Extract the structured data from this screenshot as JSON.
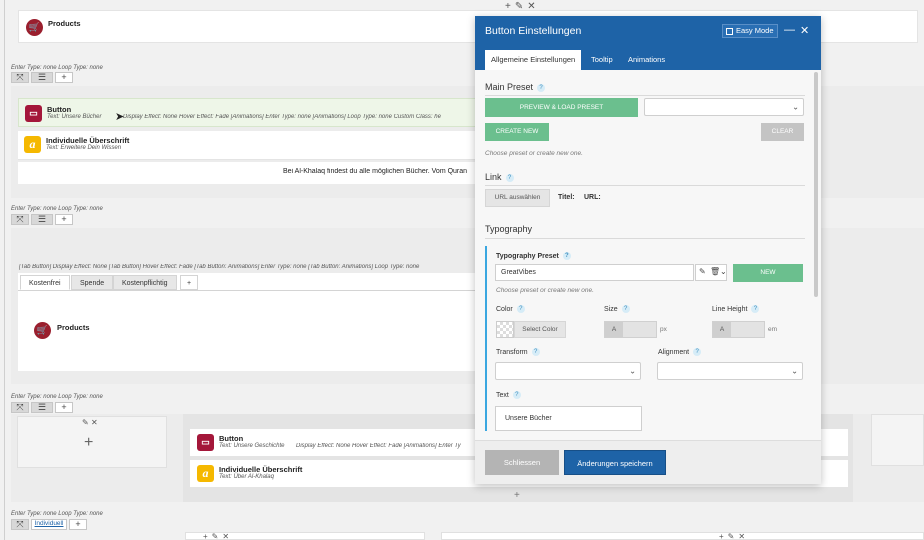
{
  "canvas": {
    "enter_type_label": "Enter Type: none  Loop Type: none",
    "products_label": "Products",
    "row_text": "Bei Al-Khalaq findest du alle möglichen Bücher. Vom Quran",
    "button_title": "Button",
    "button_sub": "Text: Unsere Bücher",
    "button_meta": "Display Effect: None      Hover Effect: Fade      [Animations] Enter Type: none      [Animations] Loop Type: none      Custom Class: he",
    "heading_title": "Individuelle Überschrift",
    "heading_sub": "Text: Erweitere Dein Wissen",
    "tab_meta": "[Tab Button] Display Effect: None    [Tab Button] Hover Effect: Fade    [Tab Button: Animations] Enter Type: none    [Tab Button: Animations] Loop Type: none",
    "tabs": [
      "Kostenfrei",
      "Spende",
      "Kostenpflichtig"
    ],
    "button2_title": "Button",
    "button2_sub": "Text: Unsere Geschichte",
    "button2_meta": "Display Effect: None      Hover Effect: Fade      [Animations] Enter Ty",
    "heading2_title": "Individuelle Überschrift",
    "heading2_sub": "Text: Über Al-Khalaq",
    "bottom_tab": "Individuell",
    "icons": {
      "move": "move-icon",
      "layout": "columns-icon",
      "add": "plus-icon",
      "edit": "pencil-icon",
      "close": "close-icon"
    }
  },
  "modal": {
    "title": "Button Einstellungen",
    "easy_mode": "Easy Mode",
    "tabs": [
      "Allgemeine Einstellungen",
      "Tooltip",
      "Animations"
    ],
    "main_preset": "Main Preset",
    "preview_btn": "PREVIEW & LOAD PRESET",
    "create_new": "CREATE NEW",
    "clear": "CLEAR",
    "preset_hint": "Choose preset or create new one.",
    "link": "Link",
    "url_btn": "URL auswählen",
    "titel": "Titel:",
    "url": "URL:",
    "typography": "Typography",
    "typo_preset": "Typography Preset",
    "typo_value": "GreatVibes",
    "new_btn": "NEW",
    "typo_hint": "Choose preset or create new one.",
    "color": "Color",
    "select_color": "Select Color",
    "size": "Size",
    "size_unit": "px",
    "line_height": "Line Height",
    "lh_unit": "em",
    "num_a": "A",
    "transform": "Transform",
    "alignment": "Alignment",
    "text": "Text",
    "text_value": "Unsere Bücher",
    "cancel": "Schliessen",
    "save": "Änderungen speichern"
  }
}
